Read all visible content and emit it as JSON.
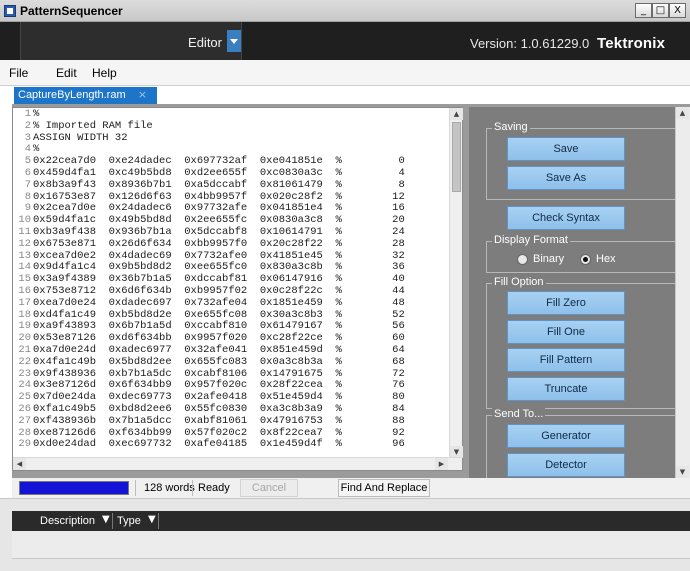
{
  "window": {
    "title": "PatternSequencer",
    "controls": [
      "_",
      "□",
      "X"
    ]
  },
  "header": {
    "view_label": "Editor",
    "version": "Version: 1.0.61229.0",
    "logo": "Tektronix"
  },
  "menu": [
    "File",
    "Edit",
    "Help"
  ],
  "tab": {
    "label": "CaptureByLength.ram",
    "close": "×"
  },
  "editor": {
    "lines": [
      "%",
      "% Imported RAM file",
      "ASSIGN WIDTH 32",
      "%",
      "0x22cea7d0  0xe24dadec  0x697732af  0xe041851e  %         0",
      "0x459d4fa1  0xc49b5bd8  0xd2ee655f  0xc0830a3c  %         4",
      "0x8b3a9f43  0x8936b7b1  0xa5dccabf  0x81061479  %         8",
      "0x16753e87  0x126d6f63  0x4bb9957f  0x020c28f2  %        12",
      "0x2cea7d0e  0x24dadec6  0x97732afe  0x041851e4  %        16",
      "0x59d4fa1c  0x49b5bd8d  0x2ee655fc  0x0830a3c8  %        20",
      "0xb3a9f438  0x936b7b1a  0x5dccabf8  0x10614791  %        24",
      "0x6753e871  0x26d6f634  0xbb9957f0  0x20c28f22  %        28",
      "0xcea7d0e2  0x4dadec69  0x7732afe0  0x41851e45  %        32",
      "0x9d4fa1c4  0x9b5bd8d2  0xee655fc0  0x830a3c8b  %        36",
      "0x3a9f4389  0x36b7b1a5  0xdccabf81  0x06147916  %        40",
      "0x753e8712  0x6d6f634b  0xb9957f02  0x0c28f22c  %        44",
      "0xea7d0e24  0xdadec697  0x732afe04  0x1851e459  %        48",
      "0xd4fa1c49  0xb5bd8d2e  0xe655fc08  0x30a3c8b3  %        52",
      "0xa9f43893  0x6b7b1a5d  0xccabf810  0x61479167  %        56",
      "0x53e87126  0xd6f634bb  0x9957f020  0xc28f22ce  %        60",
      "0xa7d0e24d  0xadec6977  0x32afe041  0x851e459d  %        64",
      "0x4fa1c49b  0x5bd8d2ee  0x655fc083  0x0a3c8b3a  %        68",
      "0x9f438936  0xb7b1a5dc  0xcabf8106  0x14791675  %        72",
      "0x3e87126d  0x6f634bb9  0x957f020c  0x28f22cea  %        76",
      "0x7d0e24da  0xdec69773  0x2afe0418  0x51e459d4  %        80",
      "0xfa1c49b5  0xbd8d2ee6  0x55fc0830  0xa3c8b3a9  %        84",
      "0xf438936b  0x7b1a5dcc  0xabf81061  0x47916753  %        88",
      "0xe87126d6  0xf634bb99  0x57f020c2  0x8f22cea7  %        92",
      "0xd0e24dad  0xec697732  0xafe04185  0x1e459d4f  %        96"
    ]
  },
  "panel": {
    "saving": {
      "title": "Saving",
      "save": "Save",
      "save_as": "Save As"
    },
    "check_syntax": "Check Syntax",
    "display_format": {
      "title": "Display Format",
      "binary": "Binary",
      "hex": "Hex",
      "selected": "Hex"
    },
    "fill_option": {
      "title": "Fill Option",
      "fill_zero": "Fill Zero",
      "fill_one": "Fill One",
      "fill_pattern": "Fill Pattern",
      "truncate": "Truncate"
    },
    "send_to": {
      "title": "Send To...",
      "generator": "Generator",
      "detector": "Detector"
    }
  },
  "status": {
    "words": "128 words",
    "state": "Ready",
    "cancel": "Cancel",
    "find_replace": "Find And Replace",
    "progress": 1.0,
    "progress_color": "#1414d6"
  },
  "bottom_grid": {
    "columns": [
      "Description",
      "Type"
    ],
    "filter_icon": "filter-icon"
  },
  "colors": {
    "accent": "#1c75c9",
    "button": "#a7d1f3",
    "panel": "#7d7d7d",
    "header": "#1f1f1f"
  }
}
